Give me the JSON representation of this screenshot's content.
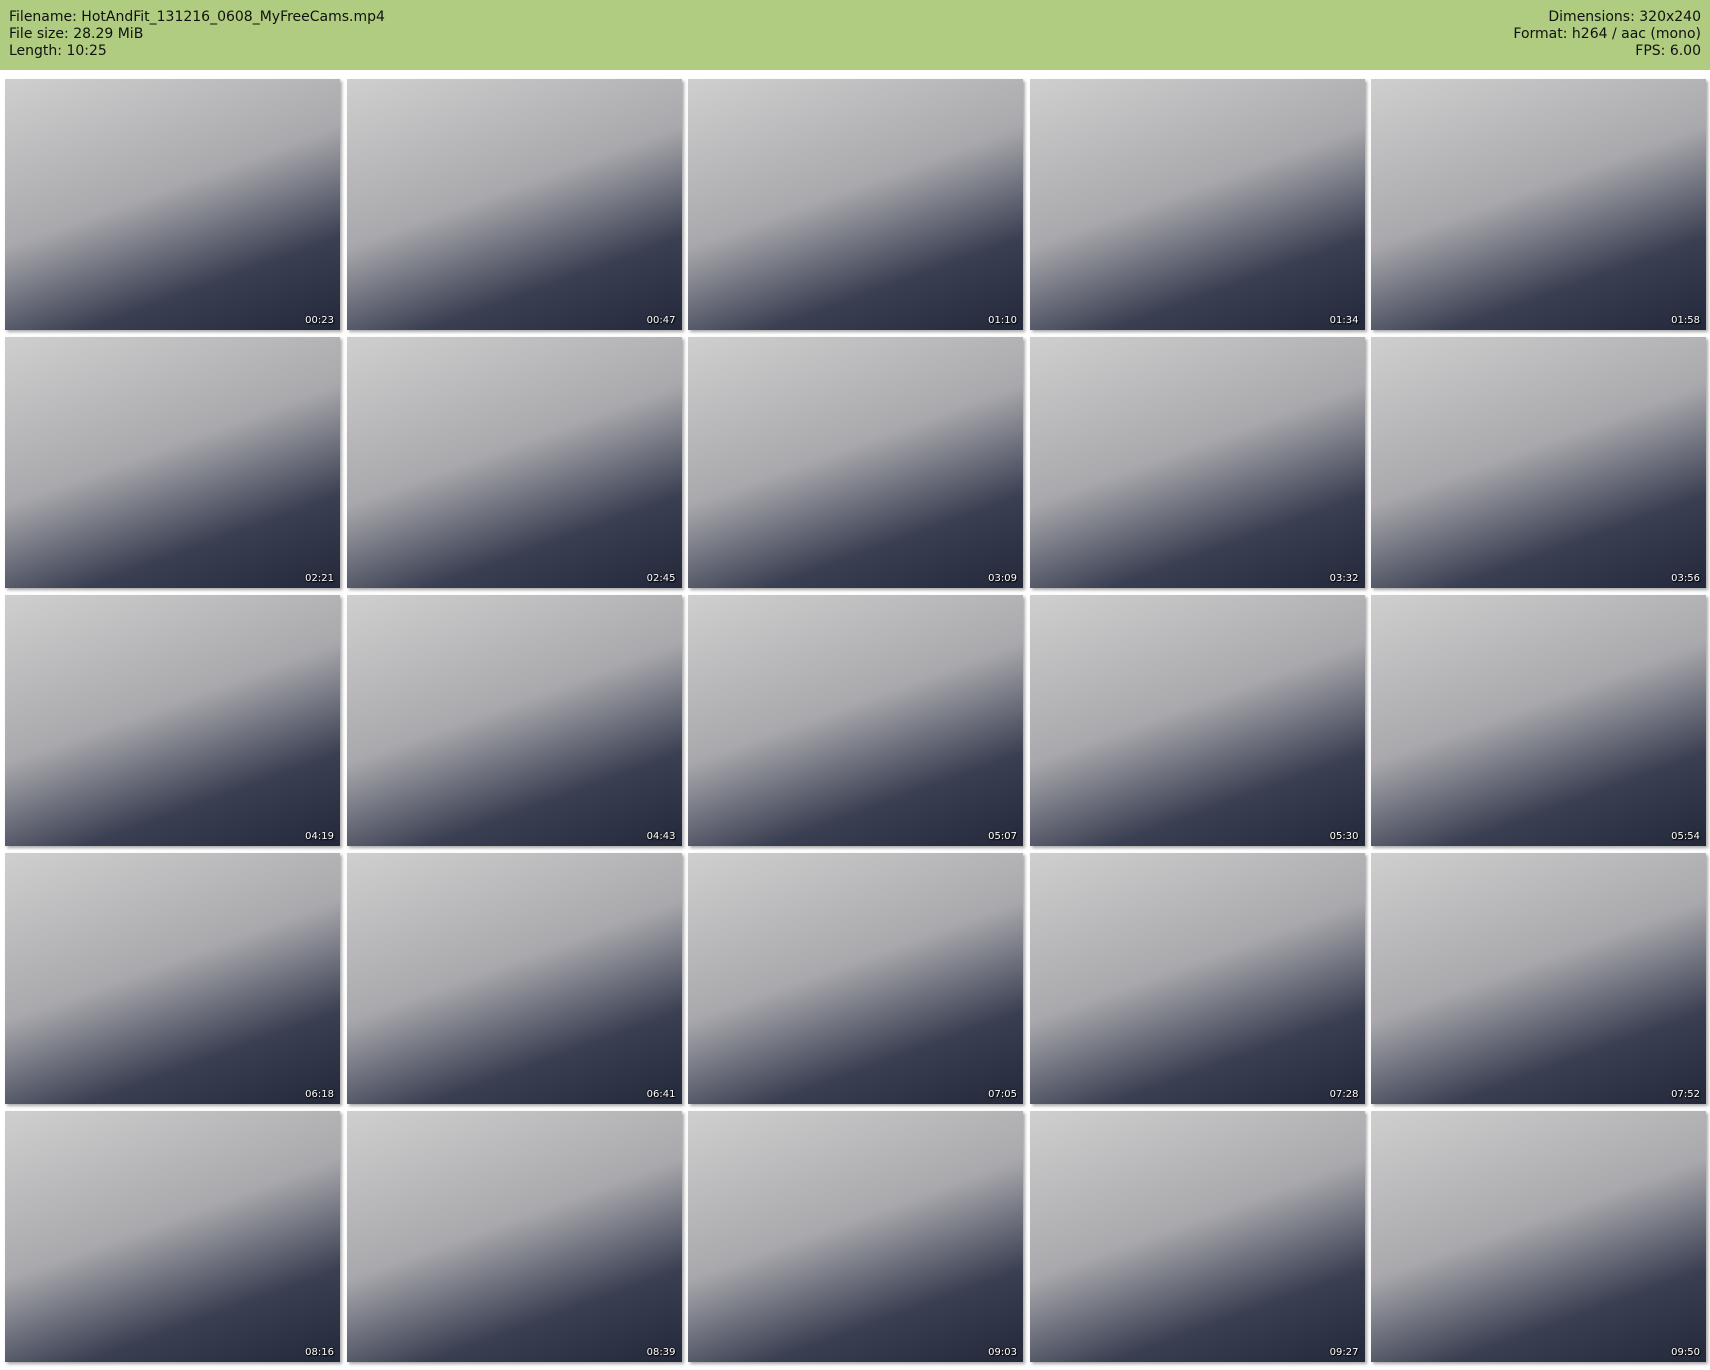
{
  "header": {
    "filename": "Filename: HotAndFit_131216_0608_MyFreeCams.mp4",
    "filesize": "File size: 28.29 MiB",
    "length": "Length: 10:25",
    "dimensions": "Dimensions: 320x240",
    "format": "Format: h264 / aac (mono)",
    "fps": "FPS: 6.00"
  },
  "thumbnails": [
    "00:23",
    "00:47",
    "01:10",
    "01:34",
    "01:58",
    "02:21",
    "02:45",
    "03:09",
    "03:32",
    "03:56",
    "04:19",
    "04:43",
    "05:07",
    "05:30",
    "05:54",
    "06:18",
    "06:41",
    "07:05",
    "07:28",
    "07:52",
    "08:16",
    "08:39",
    "09:03",
    "09:27",
    "09:50"
  ]
}
